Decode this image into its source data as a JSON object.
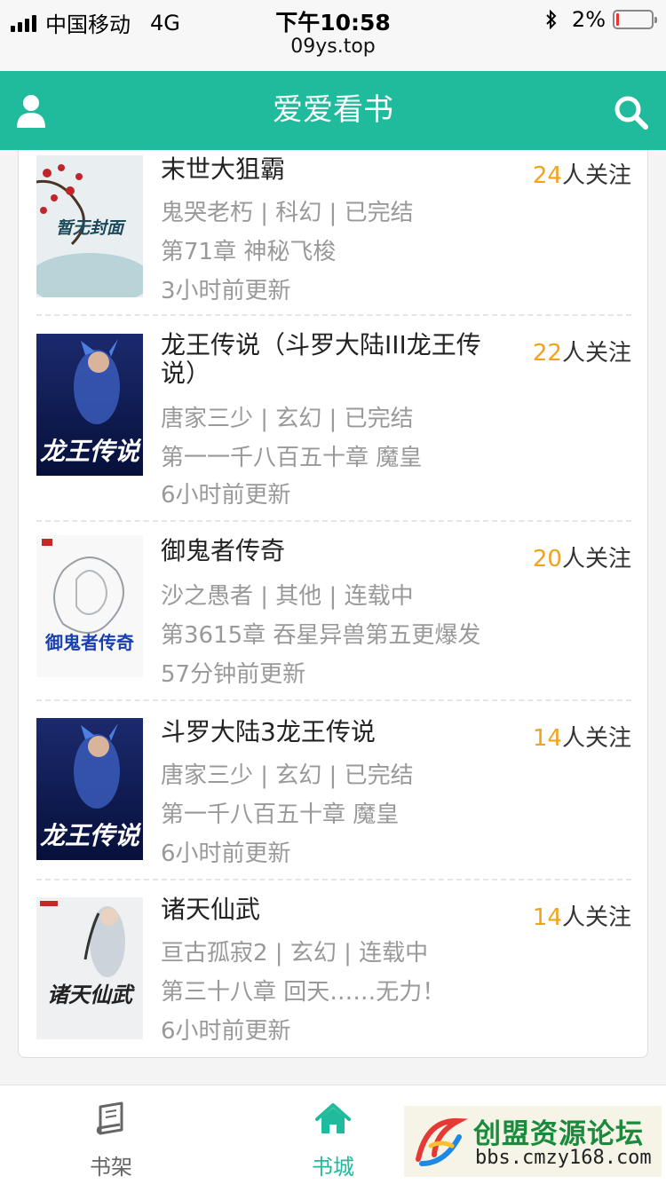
{
  "status_bar": {
    "carrier": "中国移动",
    "network": "4G",
    "time": "下午10:58",
    "url": "09ys.top",
    "battery": "2%"
  },
  "header": {
    "title": "爱爱看书",
    "left_icon": "user-icon",
    "right_icon": "search-icon",
    "color": "#1fbb9c"
  },
  "books": [
    {
      "title": "末世大狙霸",
      "follow_count": "24",
      "follow_suffix": "人关注",
      "meta": "鬼哭老朽 | 科幻 | 已完结",
      "latest": "第71章 神秘飞梭",
      "updated": "3小时前更新",
      "cover_text": "暂无封面"
    },
    {
      "title": "龙王传说（斗罗大陆III龙王传说）",
      "follow_count": "22",
      "follow_suffix": "人关注",
      "meta": "唐家三少 | 玄幻 | 已完结",
      "latest": "第一一千八百五十章 魔皇",
      "updated": "6小时前更新",
      "cover_text": "龙王传说"
    },
    {
      "title": "御鬼者传奇",
      "follow_count": "20",
      "follow_suffix": "人关注",
      "meta": "沙之愚者 | 其他 | 连载中",
      "latest": "第3615章 吞星异兽第五更爆发",
      "updated": "57分钟前更新",
      "cover_text": "御鬼者传奇"
    },
    {
      "title": "斗罗大陆3龙王传说",
      "follow_count": "14",
      "follow_suffix": "人关注",
      "meta": "唐家三少 | 玄幻 | 已完结",
      "latest": "第一千八百五十章 魔皇",
      "updated": "6小时前更新",
      "cover_text": "龙王传说"
    },
    {
      "title": "诸天仙武",
      "follow_count": "14",
      "follow_suffix": "人关注",
      "meta": "亘古孤寂2 | 玄幻 | 连载中",
      "latest": "第三十八章 回天……无力！",
      "updated": "6小时前更新",
      "cover_text": "诸天仙武"
    }
  ],
  "tabbar": {
    "shelf_label": "书架",
    "store_label": "书城",
    "active_color": "#1fbb9c"
  },
  "watermark": {
    "title": "创盟资源论坛",
    "url": "bbs.cmzy168.com"
  }
}
